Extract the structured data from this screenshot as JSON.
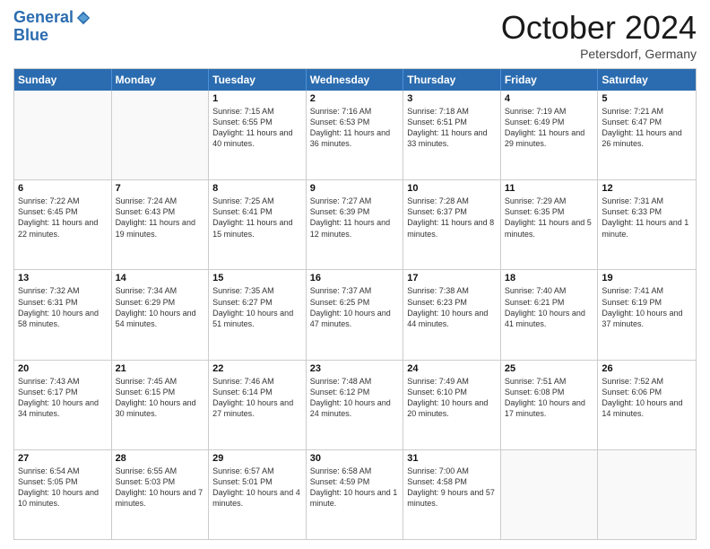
{
  "header": {
    "logo_line1": "General",
    "logo_line2": "Blue",
    "month": "October 2024",
    "location": "Petersdorf, Germany"
  },
  "days_of_week": [
    "Sunday",
    "Monday",
    "Tuesday",
    "Wednesday",
    "Thursday",
    "Friday",
    "Saturday"
  ],
  "weeks": [
    [
      {
        "day": "",
        "sunrise": "",
        "sunset": "",
        "daylight": ""
      },
      {
        "day": "",
        "sunrise": "",
        "sunset": "",
        "daylight": ""
      },
      {
        "day": "1",
        "sunrise": "Sunrise: 7:15 AM",
        "sunset": "Sunset: 6:55 PM",
        "daylight": "Daylight: 11 hours and 40 minutes."
      },
      {
        "day": "2",
        "sunrise": "Sunrise: 7:16 AM",
        "sunset": "Sunset: 6:53 PM",
        "daylight": "Daylight: 11 hours and 36 minutes."
      },
      {
        "day": "3",
        "sunrise": "Sunrise: 7:18 AM",
        "sunset": "Sunset: 6:51 PM",
        "daylight": "Daylight: 11 hours and 33 minutes."
      },
      {
        "day": "4",
        "sunrise": "Sunrise: 7:19 AM",
        "sunset": "Sunset: 6:49 PM",
        "daylight": "Daylight: 11 hours and 29 minutes."
      },
      {
        "day": "5",
        "sunrise": "Sunrise: 7:21 AM",
        "sunset": "Sunset: 6:47 PM",
        "daylight": "Daylight: 11 hours and 26 minutes."
      }
    ],
    [
      {
        "day": "6",
        "sunrise": "Sunrise: 7:22 AM",
        "sunset": "Sunset: 6:45 PM",
        "daylight": "Daylight: 11 hours and 22 minutes."
      },
      {
        "day": "7",
        "sunrise": "Sunrise: 7:24 AM",
        "sunset": "Sunset: 6:43 PM",
        "daylight": "Daylight: 11 hours and 19 minutes."
      },
      {
        "day": "8",
        "sunrise": "Sunrise: 7:25 AM",
        "sunset": "Sunset: 6:41 PM",
        "daylight": "Daylight: 11 hours and 15 minutes."
      },
      {
        "day": "9",
        "sunrise": "Sunrise: 7:27 AM",
        "sunset": "Sunset: 6:39 PM",
        "daylight": "Daylight: 11 hours and 12 minutes."
      },
      {
        "day": "10",
        "sunrise": "Sunrise: 7:28 AM",
        "sunset": "Sunset: 6:37 PM",
        "daylight": "Daylight: 11 hours and 8 minutes."
      },
      {
        "day": "11",
        "sunrise": "Sunrise: 7:29 AM",
        "sunset": "Sunset: 6:35 PM",
        "daylight": "Daylight: 11 hours and 5 minutes."
      },
      {
        "day": "12",
        "sunrise": "Sunrise: 7:31 AM",
        "sunset": "Sunset: 6:33 PM",
        "daylight": "Daylight: 11 hours and 1 minute."
      }
    ],
    [
      {
        "day": "13",
        "sunrise": "Sunrise: 7:32 AM",
        "sunset": "Sunset: 6:31 PM",
        "daylight": "Daylight: 10 hours and 58 minutes."
      },
      {
        "day": "14",
        "sunrise": "Sunrise: 7:34 AM",
        "sunset": "Sunset: 6:29 PM",
        "daylight": "Daylight: 10 hours and 54 minutes."
      },
      {
        "day": "15",
        "sunrise": "Sunrise: 7:35 AM",
        "sunset": "Sunset: 6:27 PM",
        "daylight": "Daylight: 10 hours and 51 minutes."
      },
      {
        "day": "16",
        "sunrise": "Sunrise: 7:37 AM",
        "sunset": "Sunset: 6:25 PM",
        "daylight": "Daylight: 10 hours and 47 minutes."
      },
      {
        "day": "17",
        "sunrise": "Sunrise: 7:38 AM",
        "sunset": "Sunset: 6:23 PM",
        "daylight": "Daylight: 10 hours and 44 minutes."
      },
      {
        "day": "18",
        "sunrise": "Sunrise: 7:40 AM",
        "sunset": "Sunset: 6:21 PM",
        "daylight": "Daylight: 10 hours and 41 minutes."
      },
      {
        "day": "19",
        "sunrise": "Sunrise: 7:41 AM",
        "sunset": "Sunset: 6:19 PM",
        "daylight": "Daylight: 10 hours and 37 minutes."
      }
    ],
    [
      {
        "day": "20",
        "sunrise": "Sunrise: 7:43 AM",
        "sunset": "Sunset: 6:17 PM",
        "daylight": "Daylight: 10 hours and 34 minutes."
      },
      {
        "day": "21",
        "sunrise": "Sunrise: 7:45 AM",
        "sunset": "Sunset: 6:15 PM",
        "daylight": "Daylight: 10 hours and 30 minutes."
      },
      {
        "day": "22",
        "sunrise": "Sunrise: 7:46 AM",
        "sunset": "Sunset: 6:14 PM",
        "daylight": "Daylight: 10 hours and 27 minutes."
      },
      {
        "day": "23",
        "sunrise": "Sunrise: 7:48 AM",
        "sunset": "Sunset: 6:12 PM",
        "daylight": "Daylight: 10 hours and 24 minutes."
      },
      {
        "day": "24",
        "sunrise": "Sunrise: 7:49 AM",
        "sunset": "Sunset: 6:10 PM",
        "daylight": "Daylight: 10 hours and 20 minutes."
      },
      {
        "day": "25",
        "sunrise": "Sunrise: 7:51 AM",
        "sunset": "Sunset: 6:08 PM",
        "daylight": "Daylight: 10 hours and 17 minutes."
      },
      {
        "day": "26",
        "sunrise": "Sunrise: 7:52 AM",
        "sunset": "Sunset: 6:06 PM",
        "daylight": "Daylight: 10 hours and 14 minutes."
      }
    ],
    [
      {
        "day": "27",
        "sunrise": "Sunrise: 6:54 AM",
        "sunset": "Sunset: 5:05 PM",
        "daylight": "Daylight: 10 hours and 10 minutes."
      },
      {
        "day": "28",
        "sunrise": "Sunrise: 6:55 AM",
        "sunset": "Sunset: 5:03 PM",
        "daylight": "Daylight: 10 hours and 7 minutes."
      },
      {
        "day": "29",
        "sunrise": "Sunrise: 6:57 AM",
        "sunset": "Sunset: 5:01 PM",
        "daylight": "Daylight: 10 hours and 4 minutes."
      },
      {
        "day": "30",
        "sunrise": "Sunrise: 6:58 AM",
        "sunset": "Sunset: 4:59 PM",
        "daylight": "Daylight: 10 hours and 1 minute."
      },
      {
        "day": "31",
        "sunrise": "Sunrise: 7:00 AM",
        "sunset": "Sunset: 4:58 PM",
        "daylight": "Daylight: 9 hours and 57 minutes."
      },
      {
        "day": "",
        "sunrise": "",
        "sunset": "",
        "daylight": ""
      },
      {
        "day": "",
        "sunrise": "",
        "sunset": "",
        "daylight": ""
      }
    ]
  ]
}
